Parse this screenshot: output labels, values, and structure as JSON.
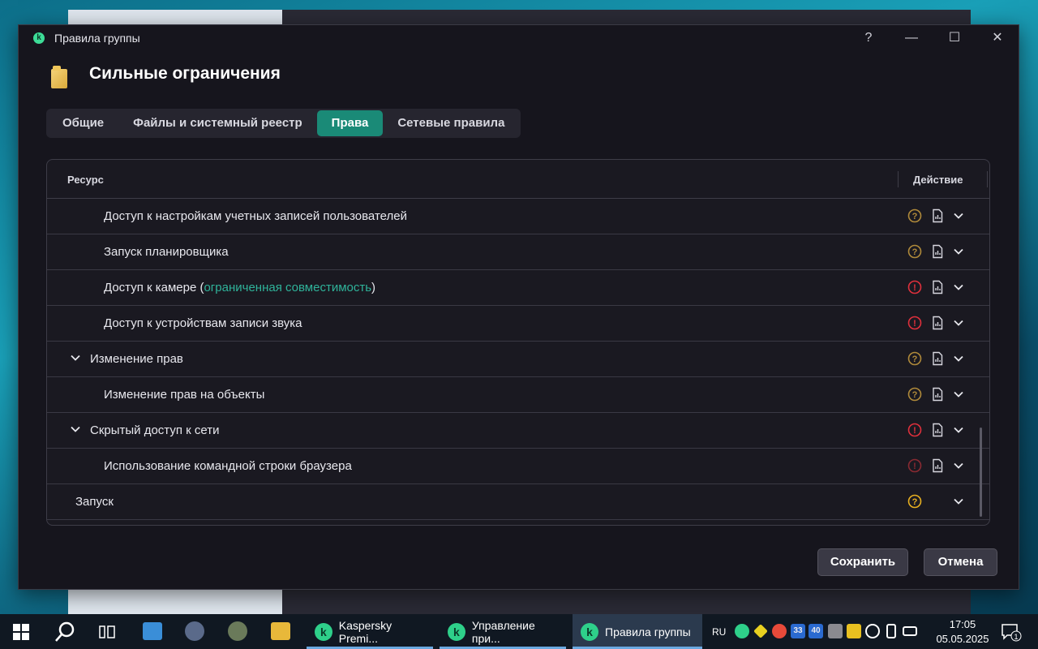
{
  "window": {
    "title": "Правила группы",
    "help_glyph": "?",
    "minimize_glyph": "—",
    "maximize_glyph": "☐",
    "close_glyph": "✕"
  },
  "header": {
    "title": "Сильные ограничения",
    "icon": "folder-icon"
  },
  "tabs": [
    {
      "label": "Общие",
      "active": false
    },
    {
      "label": "Файлы и системный реестр",
      "active": false
    },
    {
      "label": "Права",
      "active": true
    },
    {
      "label": "Сетевые правила",
      "active": false
    }
  ],
  "table": {
    "col_resource": "Ресурс",
    "col_action": "Действие",
    "rows": [
      {
        "label": "Доступ к настройкам учетных записей пользователей",
        "level": 2,
        "status": "ask",
        "expand": false
      },
      {
        "label": "Запуск планировщика",
        "level": 2,
        "status": "ask",
        "expand": false
      },
      {
        "label_pre": "Доступ к камере (",
        "label_link": "ограниченная совместимость",
        "label_post": ")",
        "level": 2,
        "status": "deny",
        "expand": false
      },
      {
        "label": "Доступ к устройствам записи звука",
        "level": 2,
        "status": "deny",
        "expand": false
      },
      {
        "label": "Изменение прав",
        "level": 1,
        "status": "ask",
        "expand": true
      },
      {
        "label": "Изменение прав на объекты",
        "level": 2,
        "status": "ask",
        "expand": false
      },
      {
        "label": "Скрытый доступ к сети",
        "level": 1,
        "status": "deny",
        "expand": true
      },
      {
        "label": "Использование командной строки браузера",
        "level": 2,
        "status": "deny-dim",
        "expand": false
      },
      {
        "label": "Запуск",
        "level": 0,
        "status": "ask-bright",
        "expand": false,
        "no_log": true
      }
    ]
  },
  "buttons": {
    "save": "Сохранить",
    "cancel": "Отмена"
  },
  "colors": {
    "accent": "#1a8a77",
    "link": "#2fb39a",
    "ask": "#b08a3a",
    "ask_bright": "#e8b020",
    "deny": "#e0303c",
    "deny_dim": "#8a2a32"
  },
  "taskbar": {
    "apps": [
      {
        "label": "Kaspersky Premi...",
        "active": false
      },
      {
        "label": "Управление при...",
        "active": false
      },
      {
        "label": "Правила группы",
        "active": true
      }
    ],
    "lang": "RU",
    "tray_numbers": [
      "33",
      "40"
    ],
    "time": "17:05",
    "date": "05.05.2025",
    "notifications": "1"
  }
}
